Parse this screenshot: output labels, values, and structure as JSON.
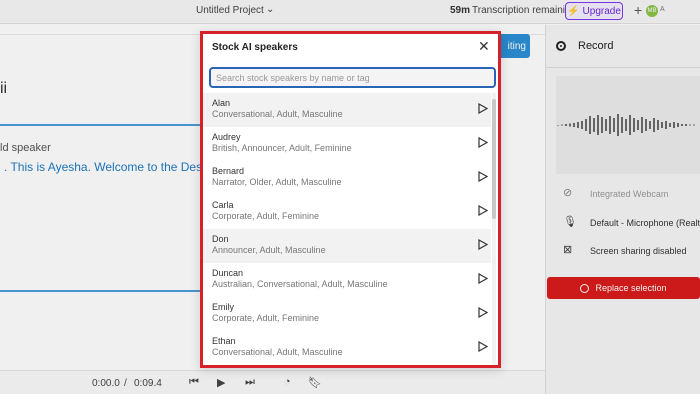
{
  "topbar": {
    "project_title": "Untitled Project",
    "minutes": "59m",
    "remaining": "Transcription remaining",
    "upgrade_label": "Upgrade",
    "avatar_initials": "MB",
    "avatar_secondary": "A"
  },
  "editor": {
    "title": "ii",
    "speaker_label": "ld speaker",
    "transcript": ". This is Ayesha. Welcome to the Descr",
    "partial_button": "iting"
  },
  "playback": {
    "current": "0:00.0",
    "separator": "/",
    "total": "0:09.4"
  },
  "record_panel": {
    "title": "Record",
    "options": [
      {
        "icon": "webcam-off-icon",
        "label": "Integrated Webcam",
        "color": "#999999"
      },
      {
        "icon": "microphone-icon",
        "label": "Default - Microphone (Realt",
        "color": "#333333"
      },
      {
        "icon": "screen-share-off-icon",
        "label": "Screen sharing disabled",
        "color": "#333333"
      }
    ],
    "replace_label": "Replace selection",
    "replace_color": "#d91c1c"
  },
  "modal": {
    "title": "Stock AI speakers",
    "search_placeholder": "Search stock speakers by name or tag",
    "speakers": [
      {
        "name": "Alan",
        "tags": "Conversational, Adult, Masculine",
        "highlighted": true
      },
      {
        "name": "Audrey",
        "tags": "British, Announcer, Adult, Feminine",
        "highlighted": false
      },
      {
        "name": "Bernard",
        "tags": "Narrator, Older, Adult, Masculine",
        "highlighted": false
      },
      {
        "name": "Carla",
        "tags": "Corporate, Adult, Feminine",
        "highlighted": false
      },
      {
        "name": "Don",
        "tags": "Announcer, Adult, Masculine",
        "highlighted": true
      },
      {
        "name": "Duncan",
        "tags": "Australian, Conversational, Adult, Masculine",
        "highlighted": false
      },
      {
        "name": "Emily",
        "tags": "Corporate, Adult, Feminine",
        "highlighted": false
      },
      {
        "name": "Ethan",
        "tags": "Conversational, Adult, Masculine",
        "highlighted": false
      }
    ],
    "border_color": "#d6202a"
  }
}
